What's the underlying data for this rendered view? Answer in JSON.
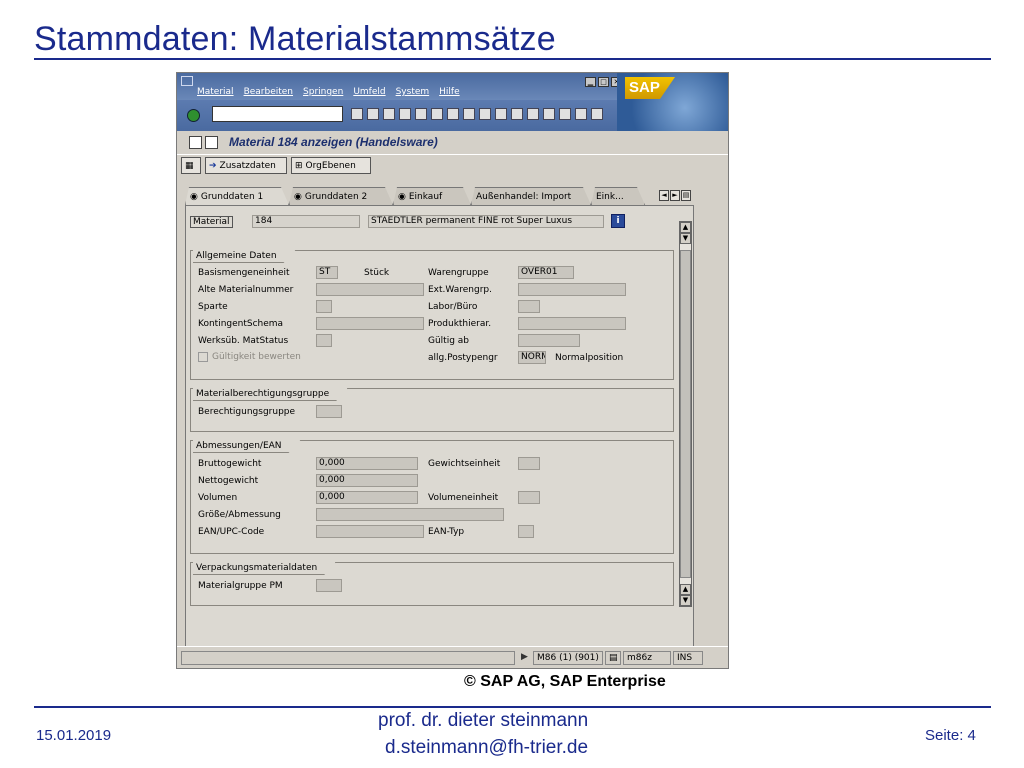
{
  "slide": {
    "title": "Stammdaten: Materialstammsätze",
    "copyright": "© SAP AG, SAP Enterprise",
    "footer_date": "15.01.2019",
    "footer_author": "prof. dr. dieter steinmann",
    "footer_email": "d.steinmann@fh-trier.de",
    "footer_page": "Seite: 4"
  },
  "sap": {
    "logo_text": "SAP",
    "menu": [
      "Material",
      "Bearbeiten",
      "Springen",
      "Umfeld",
      "System",
      "Hilfe"
    ],
    "window_title": "Material 184 anzeigen (Handelsware)",
    "app_buttons": {
      "zusatzdaten": "Zusatzdaten",
      "orgebenen": "OrgEbenen"
    },
    "tabs": [
      "Grunddaten 1",
      "Grunddaten 2",
      "Einkauf",
      "Außenhandel: Import",
      "Eink..."
    ],
    "material": {
      "label": "Material",
      "number": "184",
      "description": "STAEDTLER permanent FINE rot Super Luxus",
      "info": "i"
    },
    "allgemeine_daten": {
      "title": "Allgemeine Daten",
      "basismengeneinheit": {
        "label": "Basismengeneinheit",
        "value": "ST",
        "unit_text": "Stück"
      },
      "alte_materialnummer": {
        "label": "Alte Materialnummer",
        "value": ""
      },
      "sparte": {
        "label": "Sparte",
        "value": ""
      },
      "kontingentschema": {
        "label": "KontingentSchema",
        "value": ""
      },
      "werksub_matstatus": {
        "label": "Werksüb. MatStatus",
        "value": ""
      },
      "gueltigkeit": {
        "label": "Gültigkeit bewerten"
      },
      "warengruppe": {
        "label": "Warengruppe",
        "value": "OVER01"
      },
      "ext_warengrp": {
        "label": "Ext.Warengrp.",
        "value": ""
      },
      "labor_buero": {
        "label": "Labor/Büro",
        "value": ""
      },
      "produkthierar": {
        "label": "Produkthierar.",
        "value": ""
      },
      "gueltig_ab": {
        "label": "Gültig ab",
        "value": ""
      },
      "allg_postypengr": {
        "label": "allg.Postypengr",
        "value": "NORM",
        "text": "Normalposition"
      }
    },
    "berechtigung": {
      "title": "Materialberechtigungsgruppe",
      "label": "Berechtigungsgruppe",
      "value": ""
    },
    "abmessungen": {
      "title": "Abmessungen/EAN",
      "bruttogewicht": {
        "label": "Bruttogewicht",
        "value": "0,000"
      },
      "nettogewicht": {
        "label": "Nettogewicht",
        "value": "0,000"
      },
      "volumen": {
        "label": "Volumen",
        "value": "0,000"
      },
      "groesse": {
        "label": "Größe/Abmessung",
        "value": ""
      },
      "ean_upc": {
        "label": "EAN/UPC-Code",
        "value": ""
      },
      "gewichtseinheit": {
        "label": "Gewichtseinheit",
        "value": ""
      },
      "volumeneinheit": {
        "label": "Volumeneinheit",
        "value": ""
      },
      "ean_typ": {
        "label": "EAN-Typ",
        "value": ""
      }
    },
    "verpackung": {
      "title": "Verpackungsmaterialdaten",
      "label": "Materialgruppe PM",
      "value": ""
    },
    "status": {
      "system": "M86 (1) (901)",
      "client": "m86z",
      "mode": "INS"
    }
  }
}
